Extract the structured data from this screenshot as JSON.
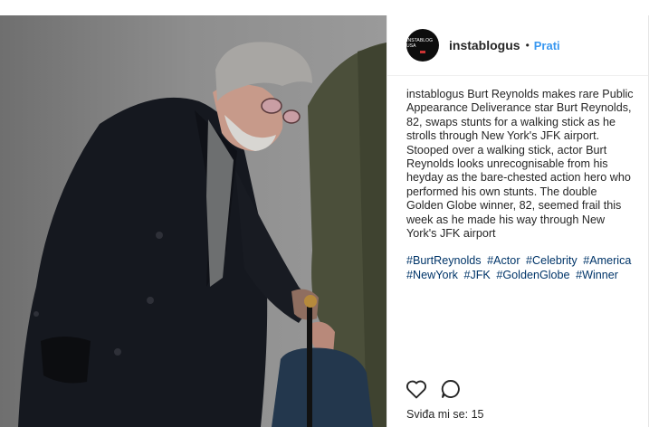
{
  "post": {
    "username": "instablogus",
    "separator": "•",
    "follow_label": "Prati",
    "avatar_text": "INSTABLOG USA",
    "caption_user": "instablogus",
    "caption_text": "Burt Reynolds makes rare Public Appearance Deliverance star Burt Reynolds, 82, swaps stunts for a walking stick as he strolls through New York's JFK airport. Stooped over a walking stick, actor Burt Reynolds looks unrecognisable from his heyday as the bare-chested action hero who performed his own stunts. The double Golden Globe winner, 82, seemed frail this week as he made his way through New York's JFK airport",
    "hashtags": [
      "#BurtReynolds",
      "#Actor",
      "#Celebrity",
      "#America",
      "#NewYork",
      "#JFK",
      "#GoldenGlobe",
      "#Winner"
    ],
    "likes_label": "Sviđa mi se:",
    "likes_count": "15"
  },
  "icons": {
    "like": "heart-icon",
    "comment": "comment-bubble-icon"
  },
  "colors": {
    "link": "#3897f0",
    "hashtag": "#003569",
    "text": "#262626"
  }
}
